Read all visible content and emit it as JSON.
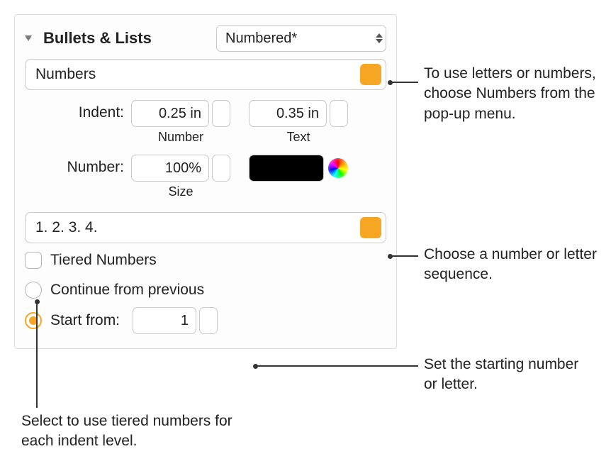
{
  "section_title": "Bullets & Lists",
  "style_popup": "Numbered*",
  "type_popup": "Numbers",
  "indent": {
    "label": "Indent:",
    "number_value": "0.25 in",
    "number_sub": "Number",
    "text_value": "0.35 in",
    "text_sub": "Text"
  },
  "number": {
    "label": "Number:",
    "size_value": "100%",
    "size_sub": "Size"
  },
  "sequence_popup": "1. 2. 3. 4.",
  "tiered_label": "Tiered Numbers",
  "continue_label": "Continue from previous",
  "start_from_label": "Start from:",
  "start_from_value": "1",
  "callouts": {
    "type": "To use letters or numbers, choose Numbers from the pop-up menu.",
    "sequence": "Choose a number or letter sequence.",
    "start": "Set the starting number or letter.",
    "tiered": "Select to use tiered numbers for each indent level."
  }
}
